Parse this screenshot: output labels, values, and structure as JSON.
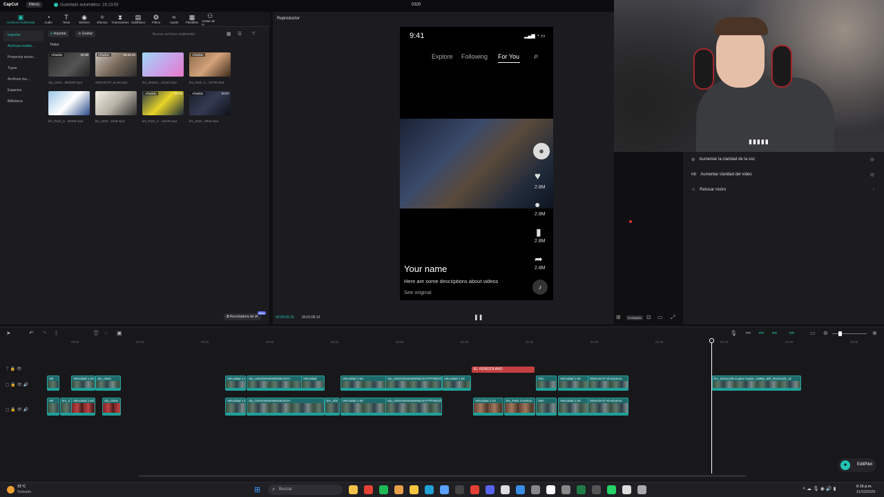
{
  "titlebar": {
    "app_name": "CapCut",
    "menu_label": "Menú",
    "autosave": "Guardado automático: 18:13:03",
    "project_name": "0320"
  },
  "toolbar": {
    "items": [
      {
        "label": "Archivos multimedia",
        "icon": "media-icon"
      },
      {
        "label": "Audio",
        "icon": "audio-icon"
      },
      {
        "label": "Texto",
        "icon": "text-icon"
      },
      {
        "label": "Stickers",
        "icon": "sticker-icon"
      },
      {
        "label": "Efectos",
        "icon": "effects-icon"
      },
      {
        "label": "Transiciones",
        "icon": "transitions-icon"
      },
      {
        "label": "Subtítulos",
        "icon": "subtitles-icon"
      },
      {
        "label": "Filtros",
        "icon": "filters-icon"
      },
      {
        "label": "Ajuste",
        "icon": "adjust-icon"
      },
      {
        "label": "Plantillas",
        "icon": "templates-icon"
      },
      {
        "label": "Avatar de IA",
        "icon": "avatar-icon"
      }
    ]
  },
  "sidenav": {
    "items": [
      "Importar",
      "Archivos multim...",
      "Proyectos secun...",
      "Tuyos",
      "Archivos mu...",
      "Espacios",
      "Biblioteca"
    ]
  },
  "media": {
    "import_label": "Importar",
    "record_label": "Grabar",
    "search_placeholder": "Buscar archivos multimedia",
    "filter_label": "Todos",
    "ai_crop_label": "Recortadora de IA",
    "ai_badge": "Beta",
    "items": [
      {
        "tag": "Añadido",
        "duration": "00:38",
        "name": "clip_01KK...B6SWP.mp4"
      },
      {
        "tag": "Añadido",
        "duration": "06:45:45",
        "name": "2026-03-07_al-uel.mp4"
      },
      {
        "tag": "",
        "duration": "",
        "name": "km_202612...22133.mp4"
      },
      {
        "tag": "Añadido",
        "duration": "",
        "name": "km_Pack_C...10728.mp4"
      },
      {
        "tag": "",
        "duration": "",
        "name": "km_Pack_C...55409.mp4"
      },
      {
        "tag": "",
        "duration": "",
        "name": "km_2024...1649.mp4"
      },
      {
        "tag": "Añadido",
        "duration": "00:15",
        "name": "km_Pack_C...15449.mp4"
      },
      {
        "tag": "Añadido",
        "duration": "00:07",
        "name": "km_2024...0816.mp4"
      }
    ]
  },
  "player": {
    "title": "Reproductor",
    "current_time": "00:00:59:15",
    "total_time": "00:01:06:13",
    "ratio_label": "Comparar"
  },
  "phone": {
    "time": "9:41",
    "tabs": [
      "Explore",
      "Following",
      "For You"
    ],
    "counts": [
      "2.8M",
      "2.8M",
      "2.8M",
      "2.8M"
    ],
    "username": "Your name",
    "description": "Here are some descriptions about videos",
    "see_original": "See original"
  },
  "right_panel": {
    "items": [
      {
        "label": "Aumentar la claridad de la voz",
        "icon": "voice-icon"
      },
      {
        "label": "Aumentar claridad del video",
        "icon": "hd-icon"
      },
      {
        "label": "Retocar rostro",
        "icon": "face-icon"
      }
    ]
  },
  "timeline": {
    "ruler": [
      "00:00",
      "00:10",
      "00:20",
      "00:30",
      "00:40",
      "00:50",
      "01:00",
      "01:10",
      "01:20",
      "01:30",
      "01:40",
      "01:50",
      "02:00",
      "02:10"
    ],
    "text_clip": "EL VENEZOLANO",
    "clips_top": [
      "Vel",
      "Velocidad 1.5X",
      "clip_01KK",
      "Velocidad 1.5X",
      "clip_01KKD6A8AMSKBUXXH",
      "Velocidad",
      "Velocidad 1.5X",
      "clip_01KKD6A8AMSKBUXH7TPVBGSWP.mp4",
      "Velocidad 1.5X",
      "Velo",
      "Velocidad 1.5X",
      "2026-03-07-el-universo",
      "km_20241228-Copiar-Copiar_1080p_60f_20241229_12"
    ],
    "clips_bottom": [
      "Vel",
      "km_2",
      "Velocidad 1.5X",
      "clip_01KK",
      "Velocidad 1.5X",
      "clip_01KKD6A8AMSKBUXXH",
      "km_202",
      "Velocidad 1.5X",
      "clip_01KKD6A8AMSKBUXH7TPVBGSWP.mp4",
      "Velocidad 1.2X",
      "km_Pack Construc",
      "Velo",
      "Velocidad 1.5X",
      "2026-03-07-el-universo"
    ],
    "plugin_label": "EditPilot"
  },
  "taskbar": {
    "weather_temp": "31°C",
    "weather_text": "Soleado",
    "search_placeholder": "Buscar",
    "time": "6:15 p.m.",
    "date": "21/03/2026"
  },
  "colors": {
    "accent": "#22c3b1",
    "clip": "#1e6a6a",
    "text_clip": "#c44040",
    "background": "#1c1c20"
  }
}
